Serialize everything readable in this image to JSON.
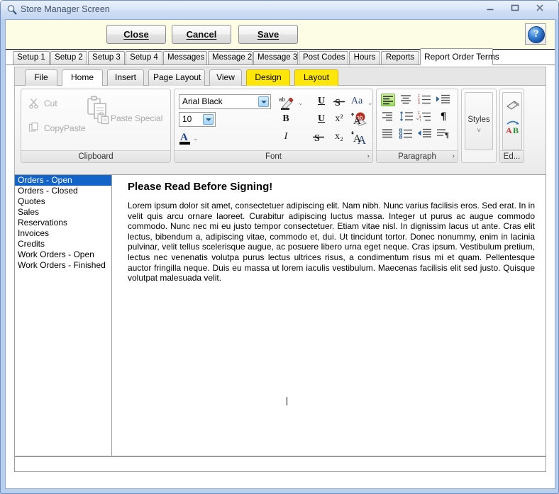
{
  "window": {
    "title": "Store Manager Screen",
    "icon": "magnifier-icon",
    "minimize": "–",
    "maximize": "▭",
    "close": "✕"
  },
  "commandbar": {
    "close_label": "Close",
    "cancel_label": "Cancel",
    "save_label": "Save",
    "help_label": "?",
    "background": "#fdfce4"
  },
  "outer_tabs": [
    {
      "label": "Setup 1",
      "active": false
    },
    {
      "label": "Setup 2",
      "active": false
    },
    {
      "label": "Setup 3",
      "active": false
    },
    {
      "label": "Setup 4",
      "active": false
    },
    {
      "label": "Messages",
      "active": false
    },
    {
      "label": "Message 2",
      "active": false
    },
    {
      "label": "Message 3",
      "active": false
    },
    {
      "label": "Post Codes",
      "active": false
    },
    {
      "label": "Hours",
      "active": false
    },
    {
      "label": "Reports",
      "active": false
    },
    {
      "label": "Report Order Terms",
      "active": true
    }
  ],
  "ribbon": {
    "tabs": [
      {
        "label": "File",
        "state": "normal"
      },
      {
        "label": "Home",
        "state": "active"
      },
      {
        "label": "Insert",
        "state": "normal"
      },
      {
        "label": "Page Layout",
        "state": "normal"
      },
      {
        "label": "View",
        "state": "normal"
      },
      {
        "label": "Design",
        "state": "yellow"
      },
      {
        "label": "Layout",
        "state": "yellow"
      }
    ],
    "yellow_accent": "#ffe60a",
    "groups": {
      "clipboard": {
        "label": "Clipboard",
        "cut": "Cut",
        "copy": "Copy",
        "paste": "Paste",
        "paste_special": "Paste Special",
        "disabled": true
      },
      "font": {
        "label": "Font",
        "font_name": "Arial Black",
        "font_size": "10",
        "bold": "B",
        "italic": "I",
        "underline": "U",
        "superscript": "x²",
        "subscript": "x₂",
        "strikethrough": "S",
        "change_case": "Aa",
        "grow_font": "A",
        "shrink_font": "A",
        "clear_formatting": "A",
        "text_highlight": "ab",
        "font_color": "A",
        "dialog_launcher": "›"
      },
      "paragraph": {
        "label": "Paragraph",
        "align_left_selected": true,
        "dialog_launcher": "›",
        "show_marks": "¶"
      },
      "styles": {
        "label": "Styles",
        "chevron": "˅"
      },
      "editing": {
        "label": "Ed...",
        "replace_a": "A",
        "replace_b": "B"
      }
    }
  },
  "list_panel": {
    "items": [
      {
        "label": "Orders - Open",
        "selected": true
      },
      {
        "label": "Orders - Closed",
        "selected": false
      },
      {
        "label": "Quotes",
        "selected": false
      },
      {
        "label": "Sales",
        "selected": false
      },
      {
        "label": "Reservations",
        "selected": false
      },
      {
        "label": "Invoices",
        "selected": false
      },
      {
        "label": "Credits",
        "selected": false
      },
      {
        "label": "Work Orders - Open",
        "selected": false
      },
      {
        "label": "Work Orders - Finished",
        "selected": false
      }
    ],
    "selection_color": "#1364c8"
  },
  "document": {
    "heading": "Please Read Before Signing!",
    "body": "Lorem ipsum dolor sit amet, consectetuer adipiscing elit. Nam nibh. Nunc varius facilisis eros. Sed erat. In in velit quis arcu ornare laoreet. Curabitur adipiscing luctus massa. Integer ut purus ac augue commodo commodo. Nunc nec mi eu justo tempor consectetuer. Etiam vitae nisl. In dignissim lacus ut ante. Cras elit lectus, bibendum a, adipiscing vitae, commodo et, dui. Ut tincidunt tortor. Donec nonummy, enim in lacinia pulvinar, velit tellus scelerisque augue, ac posuere libero urna eget neque. Cras ipsum. Vestibulum pretium, lectus nec venenatis volutpa purus lectus ultrices risus, a condimentum risus mi et quam. Pellentesque auctor fringilla neque. Duis eu massa ut lorem iaculis vestibulum. Maecenas facilisis elit sed justo. Quisque volutpat malesuada velit."
  }
}
